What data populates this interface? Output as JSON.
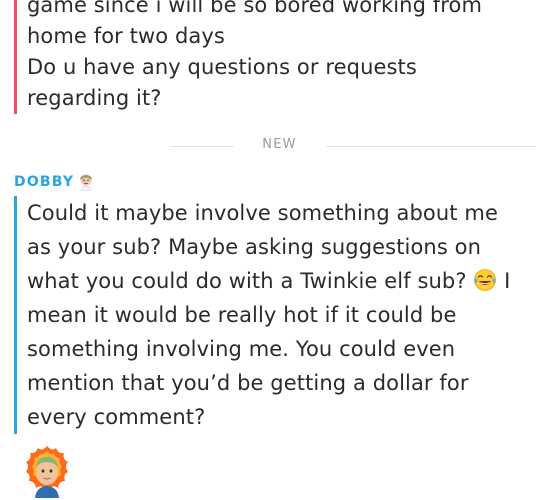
{
  "previous_message": {
    "lines": [
      "game since i will be so bored working from",
      "home for two days",
      "Do u have any questions or requests",
      "regarding it?"
    ],
    "accent_color": "#f04d5f"
  },
  "divider": {
    "label": "NEW"
  },
  "current_message": {
    "sender_name": "DOBBY",
    "accent_color": "#2ba4e0",
    "lines": [
      "Could it maybe involve something about me",
      "as your sub? Maybe asking suggestions on",
      "what you could do with a Twinkie elf sub?",
      "mean it would be really hot if it could be",
      "something involving me.  You could even",
      "mention that you’d be getting a dollar for",
      "every comment?"
    ],
    "line3_after_emoji": "I",
    "inline_emoji": "face-with-tears-of-joy-icon"
  },
  "avatar": {
    "icon": "bitmoji-avatar-icon"
  }
}
